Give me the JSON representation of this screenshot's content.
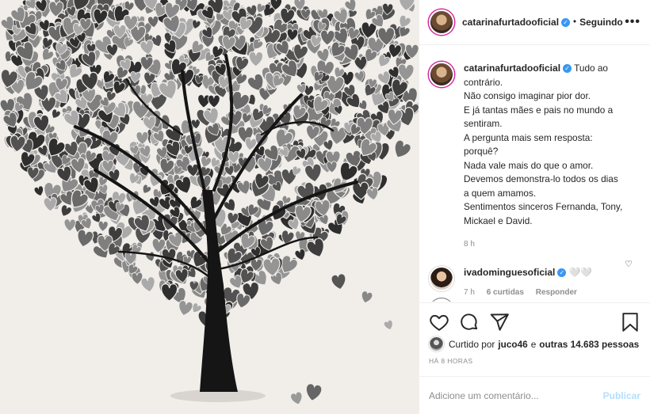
{
  "post": {
    "image": {
      "description_icon": "heart-tree-illustration-icon"
    }
  },
  "header": {
    "username": "catarinafurtadooficial",
    "verified_icon": "verified-badge-icon",
    "separator": "•",
    "follow_state": "Seguindo",
    "more_label": "•••"
  },
  "caption": {
    "username": "catarinafurtadooficial",
    "lines": [
      "Tudo ao",
      "contrário.",
      "Não consigo imaginar pior dor.",
      "E já tantas mães e pais no mundo a",
      "sentiram.",
      "A pergunta mais sem resposta:",
      "porquê?",
      "Nada vale mais do que o amor.",
      "Devemos demonstra-lo todos os dias",
      "a quem amamos.",
      "Sentimentos sinceros Fernanda, Tony,",
      "Mickael e David."
    ],
    "time": "8 h"
  },
  "comment": {
    "username": "ivadominguesoficial",
    "text": "🤍🤍",
    "time": "7 h",
    "likes": "6 curtidas",
    "reply": "Responder"
  },
  "actions": {
    "like_icon": "heart-outline-icon",
    "comment_icon": "comment-bubble-icon",
    "share_icon": "paper-plane-icon",
    "save_icon": "bookmark-icon"
  },
  "likes": {
    "prefix": "Curtido por",
    "user": "juco46",
    "middle": "e",
    "others": "outras 14.683 pessoas"
  },
  "timestamp": "HÁ 8 HORAS",
  "add_comment": {
    "placeholder": "Adicione um comentário...",
    "publish": "Publicar"
  },
  "colors": {
    "verified": "#3897f0",
    "publish_disabled": "#b2dffc",
    "muted": "#8e8e8e"
  }
}
